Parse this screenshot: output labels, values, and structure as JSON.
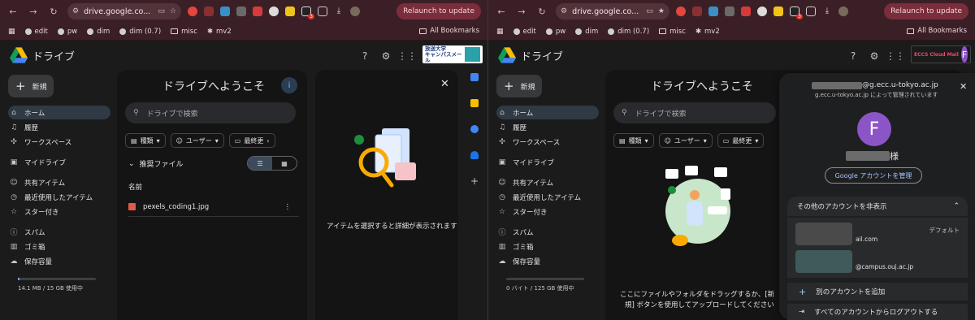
{
  "colors": {
    "chrome_bg": "#3b1f26",
    "drive_blue": "#8ab4f8",
    "avatar_purple": "#8c55c7",
    "relaunch_bg": "#7a2d3a"
  },
  "browser": {
    "url": "drive.google.co...",
    "relaunch_label": "Relaunch to update",
    "bookmarks": [
      "edit",
      "pw",
      "dim",
      "dim (0.7)",
      "misc",
      "mv2"
    ],
    "all_bookmarks": "All Bookmarks",
    "extension_badge": "3"
  },
  "drive": {
    "app_name": "ドライブ",
    "new_label": "新規",
    "nav": {
      "home": "ホーム",
      "activity": "履歴",
      "workspaces": "ワークスペース",
      "mydrive": "マイドライブ",
      "shared": "共有アイテム",
      "recent": "最近使用したアイテム",
      "starred": "スター付き",
      "spam": "スパム",
      "trash": "ゴミ箱",
      "storage": "保存容量"
    }
  },
  "left": {
    "org_badge_line1": "放送大学",
    "org_badge_line2": "キャンパスメール",
    "welcome": "ドライブへようこそ",
    "search_placeholder": "ドライブで検索",
    "chips": [
      "種類",
      "ユーザー",
      "最終更"
    ],
    "suggested": "推奨ファイル",
    "column_name": "名前",
    "file_name": "pexels_coding1.jpg",
    "details_empty": "アイテムを選択すると詳細が表示されます",
    "storage_used": "14.1 MB / 15 GB 使用中",
    "storage_fraction": 0.001
  },
  "right": {
    "org_badge": "ECCS Cloud Mail",
    "avatar_letter": "F",
    "welcome": "ドライブへようこそ",
    "search_placeholder": "ドライブで検索",
    "chips": [
      "種類",
      "ユーザー",
      "最終更"
    ],
    "storage_used": "0 バイト / 125 GB 使用中",
    "storage_fraction": 0,
    "empty_line1": "ここにファイルやフォルダをドラッグするか、[新",
    "empty_line2": "規] ボタンを使用してアップロードしてください",
    "account": {
      "email_suffix": "@g.ecc.u-tokyo.ac.jp",
      "managed_by": "g.ecc.u-tokyo.ac.jp によって管理されています",
      "honorific": "様",
      "manage_label": "Google アカウントを管理",
      "hide_other": "その他のアカウントを非表示",
      "other1_suffix": "ail.com",
      "other1_tag": "デフォルト",
      "other2_suffix": "@campus.ouj.ac.jp",
      "add_account": "別のアカウントを追加",
      "logout_all": "すべてのアカウントからログアウトする"
    }
  }
}
